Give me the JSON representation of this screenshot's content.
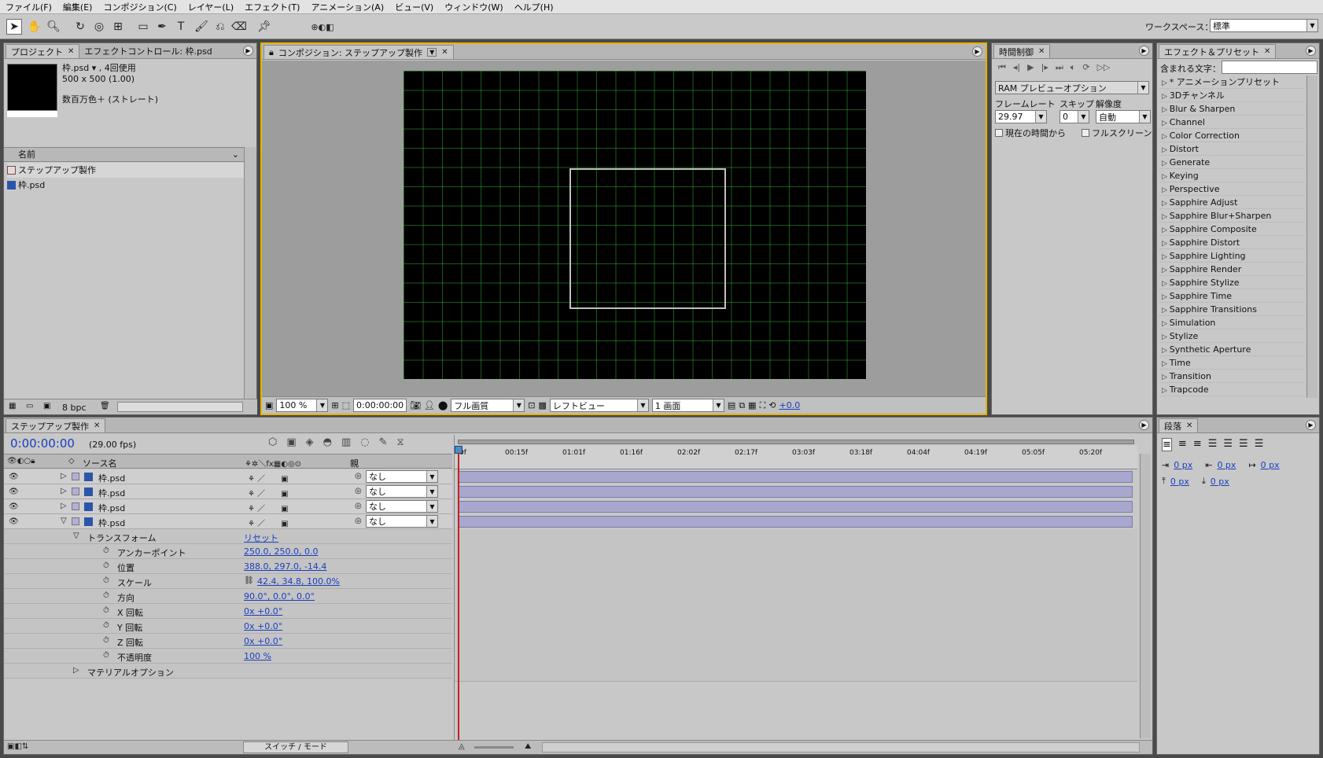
{
  "menu": [
    "ファイル(F)",
    "編集(E)",
    "コンポジション(C)",
    "レイヤー(L)",
    "エフェクト(T)",
    "アニメーション(A)",
    "ビュー(V)",
    "ウィンドウ(W)",
    "ヘルプ(H)"
  ],
  "workspace": {
    "label": "ワークスペース：",
    "value": "標準"
  },
  "project": {
    "tab_project": "プロジェクト",
    "tab_effect_controls": "エフェクトコントロール: 枠.psd",
    "file_name": "枠.psd ▾ , 4回使用",
    "file_dims": "500 x 500 (1.00)",
    "file_color": "数百万色＋ (ストレート)",
    "column_name": "名前",
    "items": [
      "ステップアップ製作",
      "枠.psd"
    ],
    "bpc": "8 bpc"
  },
  "comp": {
    "tab": "コンポジション: ステップアップ製作",
    "zoom": "100 %",
    "timecode": "0:00:00:00",
    "quality": "フル画質",
    "view": "レフトビュー",
    "screens": "1 画面",
    "exposure": "+0.0"
  },
  "time_controls": {
    "tab": "時間制御",
    "ram_preview": "RAM プレビューオプション",
    "frame_rate_label": "フレームレート",
    "skip_label": "スキップ",
    "resolution_label": "解像度",
    "frame_rate": "29.97",
    "skip": "0",
    "resolution": "自動",
    "from_current": "現在の時間から",
    "fullscreen": "フルスクリーン"
  },
  "effects": {
    "tab": "エフェクト＆プリセット",
    "search_label": "含まれる文字：",
    "items": [
      "* アニメーションプリセット",
      "3Dチャンネル",
      "Blur & Sharpen",
      "Channel",
      "Color Correction",
      "Distort",
      "Generate",
      "Keying",
      "Perspective",
      "Sapphire Adjust",
      "Sapphire Blur+Sharpen",
      "Sapphire Composite",
      "Sapphire Distort",
      "Sapphire Lighting",
      "Sapphire Render",
      "Sapphire Stylize",
      "Sapphire Time",
      "Sapphire Transitions",
      "Simulation",
      "Stylize",
      "Synthetic Aperture",
      "Time",
      "Transition",
      "Trapcode"
    ]
  },
  "timeline": {
    "tab": "ステップアップ製作",
    "timecode": "0:00:00:00",
    "fps": "(29.00 fps)",
    "col_source": "ソース名",
    "col_parent": "親",
    "ruler": [
      "0f",
      "00:15f",
      "01:01f",
      "01:16f",
      "02:02f",
      "02:17f",
      "03:03f",
      "03:18f",
      "04:04f",
      "04:19f",
      "05:05f",
      "05:20f"
    ],
    "layers": [
      {
        "name": "枠.psd",
        "parent": "なし"
      },
      {
        "name": "枠.psd",
        "parent": "なし"
      },
      {
        "name": "枠.psd",
        "parent": "なし"
      },
      {
        "name": "枠.psd",
        "parent": "なし"
      }
    ],
    "transform_label": "トランスフォーム",
    "reset": "リセット",
    "props": [
      {
        "label": "アンカーポイント",
        "value": "250.0, 250.0, 0.0"
      },
      {
        "label": "位置",
        "value": "388.0, 297.0, -14.4"
      },
      {
        "label": "スケール",
        "value": "42.4, 34.8, 100.0%"
      },
      {
        "label": "方向",
        "value": "90.0°, 0.0°, 0.0°"
      },
      {
        "label": "X 回転",
        "value": "0x +0.0°"
      },
      {
        "label": "Y 回転",
        "value": "0x +0.0°"
      },
      {
        "label": "Z 回転",
        "value": "0x +0.0°"
      },
      {
        "label": "不透明度",
        "value": "100 %"
      }
    ],
    "material": "マテリアルオプション",
    "switch_mode": "スイッチ / モード"
  },
  "paragraph": {
    "tab": "段落",
    "values": [
      "0 px",
      "0 px",
      "0 px",
      "0 px",
      "0 px"
    ]
  }
}
